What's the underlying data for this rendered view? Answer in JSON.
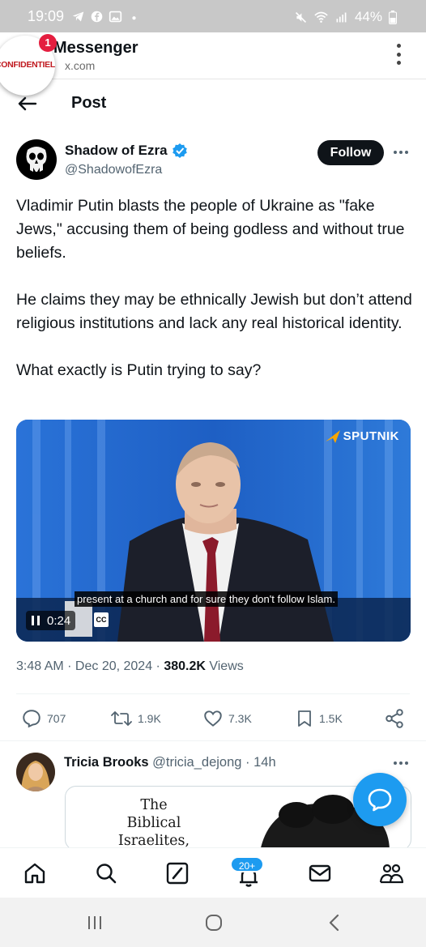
{
  "status_bar": {
    "time": "19:09",
    "battery": "44%"
  },
  "app_bar": {
    "title": "Messenger",
    "url": "x.com",
    "bubble_text": "CONFIDENTIELLTV",
    "badge_count": "1"
  },
  "post_header": {
    "title": "Post"
  },
  "tweet": {
    "author_name": "Shadow of Ezra",
    "author_handle": "@ShadowofEzra",
    "follow_label": "Follow",
    "paragraphs": [
      "Vladimir Putin blasts the people of Ukraine as \"fake Jews,\" accusing them of being godless and without true beliefs.",
      "He claims they may be ethnically Jewish but don’t attend religious institutions and lack any real historical identity.",
      "What exactly is Putin trying to say?"
    ],
    "video": {
      "caption": "present at a church and for sure they don't follow Islam.",
      "time": "0:24",
      "cc_label": "CC",
      "logo_text": "SPUTNIK"
    },
    "timestamp": "3:48 AM · Dec 20, 2024 · ",
    "views_count": "380.2K",
    "views_label": " Views",
    "actions": {
      "replies": "707",
      "reposts": "1.9K",
      "likes": "7.3K",
      "bookmarks": "1.5K"
    }
  },
  "reply": {
    "name": "Tricia Brooks",
    "handle_time": " @tricia_dejong · 14h",
    "card_text": [
      "The",
      "Biblical",
      "Israelites, and"
    ]
  },
  "bottom_nav": {
    "notification_badge": "20+"
  },
  "colors": {
    "accent": "#1d9bf0",
    "text": "#0f1419",
    "muted": "#536471",
    "verified": "#1d9bf0"
  }
}
